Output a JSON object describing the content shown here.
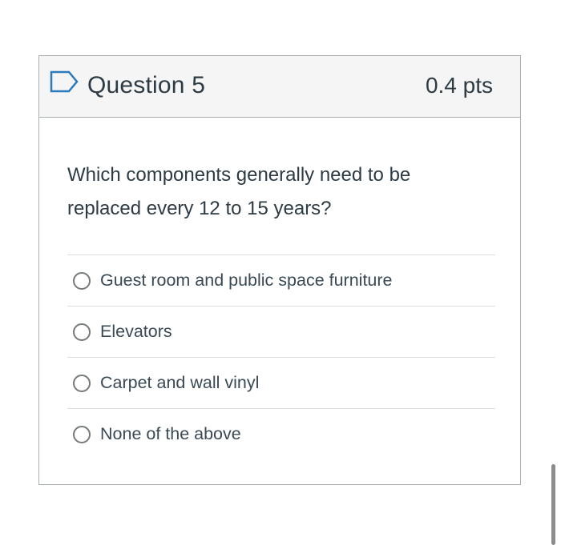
{
  "question": {
    "title": "Question 5",
    "points": "0.4 pts",
    "text": "Which components generally need to be replaced every 12 to 15 years?",
    "flag_icon": "flag-outline-icon",
    "accent_color": "#2b7abc"
  },
  "answers": [
    {
      "label": "Guest room and public space furniture"
    },
    {
      "label": "Elevators"
    },
    {
      "label": "Carpet and wall vinyl"
    },
    {
      "label": "None of the above"
    }
  ]
}
